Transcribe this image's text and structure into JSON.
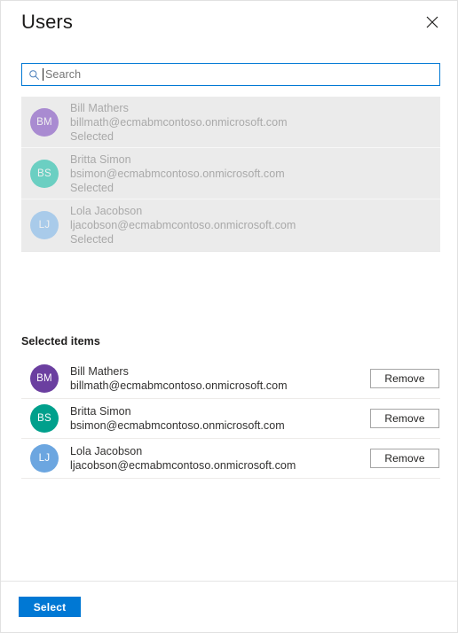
{
  "dialog": {
    "title": "Users",
    "close_icon": "close-icon"
  },
  "search": {
    "placeholder": "Search",
    "value": "",
    "icon": "search-icon"
  },
  "candidates": {
    "rows": [
      {
        "initials": "BM",
        "name": "Bill Mathers",
        "email": "billmath@ecmabmcontoso.onmicrosoft.com",
        "state": "Selected",
        "avatar_color": "#a98bd1"
      },
      {
        "initials": "BS",
        "name": "Britta Simon",
        "email": "bsimon@ecmabmcontoso.onmicrosoft.com",
        "state": "Selected",
        "avatar_color": "#6bcfc2"
      },
      {
        "initials": "LJ",
        "name": "Lola Jacobson",
        "email": "ljacobson@ecmabmcontoso.onmicrosoft.com",
        "state": "Selected",
        "avatar_color": "#a9cbea"
      }
    ]
  },
  "selected_items": {
    "heading": "Selected items",
    "rows": [
      {
        "initials": "BM",
        "name": "Bill Mathers",
        "email": "billmath@ecmabmcontoso.onmicrosoft.com",
        "remove_label": "Remove",
        "avatar_color": "#6b3fa0"
      },
      {
        "initials": "BS",
        "name": "Britta Simon",
        "email": "bsimon@ecmabmcontoso.onmicrosoft.com",
        "remove_label": "Remove",
        "avatar_color": "#00a08c"
      },
      {
        "initials": "LJ",
        "name": "Lola Jacobson",
        "email": "ljacobson@ecmabmcontoso.onmicrosoft.com",
        "remove_label": "Remove",
        "avatar_color": "#6ca6e0"
      }
    ]
  },
  "footer": {
    "select_label": "Select"
  },
  "colors": {
    "accent": "#0078d4",
    "list_background": "#ebebeb",
    "disabled_text": "#a9a9a9",
    "primary_text": "#201f1e"
  }
}
